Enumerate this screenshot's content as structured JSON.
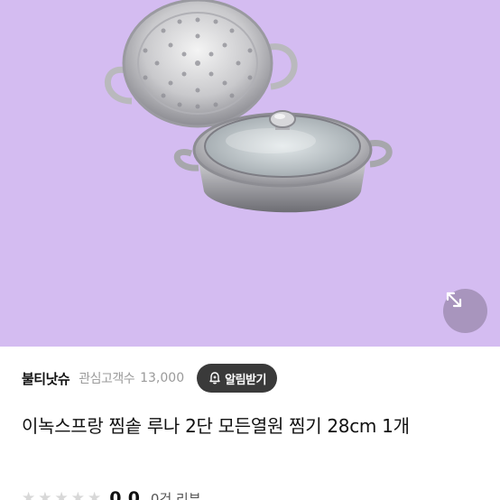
{
  "product": {
    "title": "이녹스프랑 찜솥 루나 2단 모든열원 찜기 28cm 1개",
    "image_background": "#d4bcf1"
  },
  "seller": {
    "store_name": "불티낫슈",
    "favorites_label": "관심고객수",
    "favorites_count": "13,000",
    "notify_button_label": "알림받기"
  },
  "rating": {
    "value": "0.0",
    "review_count_label": "0건 리뷰",
    "stars_filled": 0,
    "stars_total": 5
  },
  "icons": {
    "expand": "expand-arrows-icon",
    "bell": "bell-plus-icon",
    "star": "star-icon"
  },
  "colors": {
    "notify_button_bg": "#3a3a3a",
    "expand_button_bg": "#a895bd",
    "muted_text": "#9a9a9a",
    "empty_star": "#d8d8d8"
  }
}
